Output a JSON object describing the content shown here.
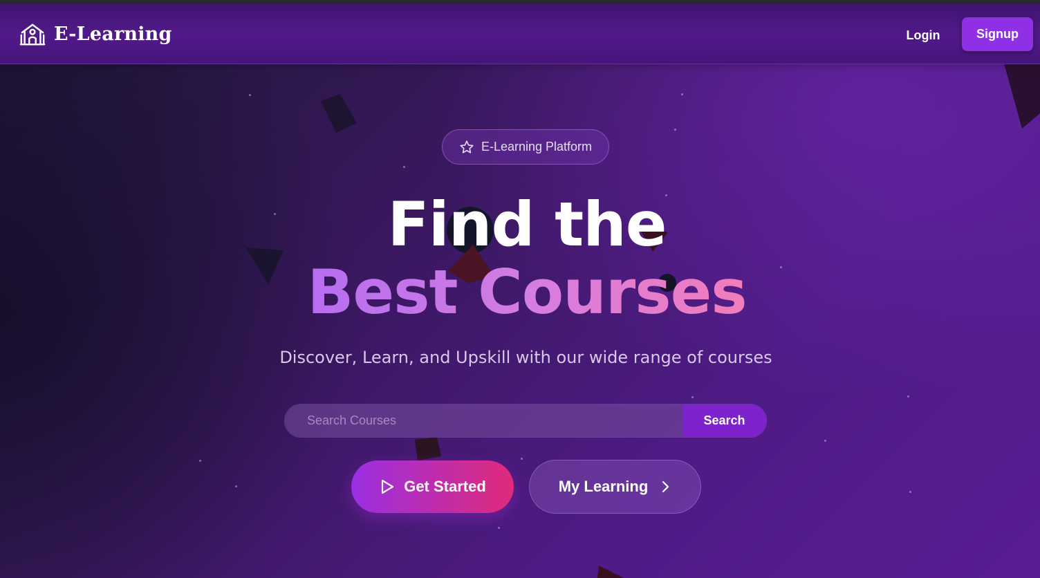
{
  "navbar": {
    "brand": "E-Learning",
    "brand_icon": "school-building-icon",
    "login_label": "Login",
    "signup_label": "Signup"
  },
  "hero": {
    "badge_icon": "star-icon",
    "badge_label": "E-Learning Platform",
    "title_line1": "Find the",
    "title_line2": "Best Courses",
    "subtitle": "Discover, Learn, and Upskill with our wide range of courses"
  },
  "search": {
    "placeholder": "Search Courses",
    "value": "",
    "button_label": "Search"
  },
  "actions": {
    "get_started_icon": "play-icon",
    "get_started_label": "Get Started",
    "my_learning_label": "My Learning",
    "my_learning_icon": "chevron-right-icon"
  },
  "colors": {
    "accent": "#8f2fe6",
    "search_button": "#7e22ce",
    "gradient_start": "#9a2fe3",
    "gradient_end": "#e02a7a",
    "title_gradient_start": "#b66df0",
    "title_gradient_end": "#f27dba"
  }
}
